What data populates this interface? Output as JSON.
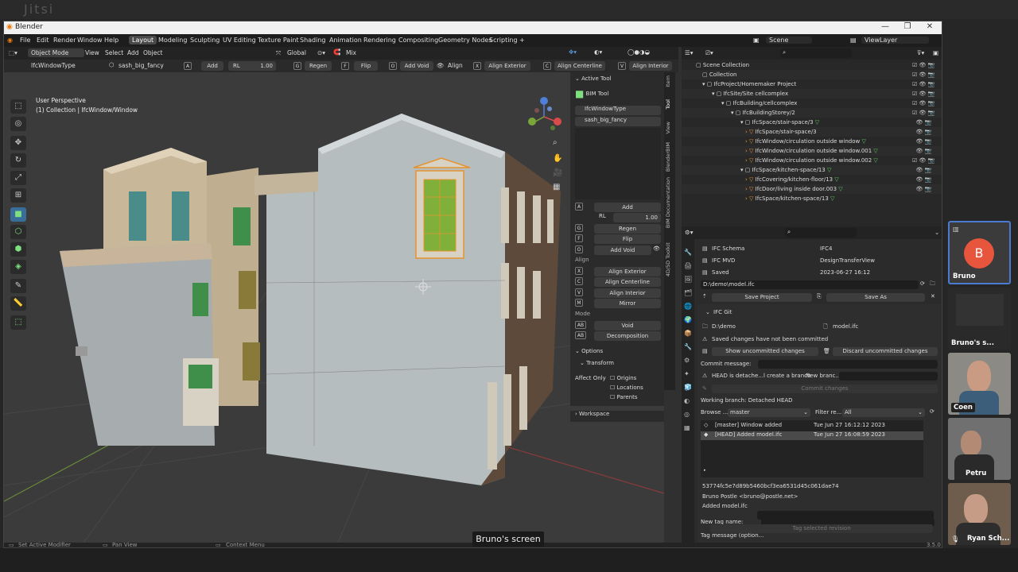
{
  "meeting": {
    "watermark": "Jitsi",
    "caption": "Bruno's screen",
    "participants": [
      {
        "name": "Bruno",
        "initial": "B",
        "accent": "#e8553d"
      },
      {
        "name": "Bruno's s..."
      },
      {
        "name": "Coen"
      },
      {
        "name": "Petru"
      },
      {
        "name": "Ryan Sch..."
      }
    ]
  },
  "window": {
    "title": "Blender"
  },
  "menu": {
    "items": [
      "File",
      "Edit",
      "Render",
      "Window",
      "Help"
    ],
    "workspaces": [
      "Layout",
      "Modeling",
      "Sculpting",
      "UV Editing",
      "Texture Paint",
      "Shading",
      "Animation",
      "Rendering",
      "Compositing",
      "Geometry Nodes",
      "Scripting",
      "+"
    ],
    "scene": "Scene",
    "view_layer": "ViewLayer"
  },
  "viewport": {
    "header": {
      "mode": "Object Mode",
      "view": "View",
      "select": "Select",
      "add": "Add",
      "object": "Object",
      "orientation": "Global",
      "shading": "Mix"
    },
    "toolheader": {
      "type": "IfcWindowType",
      "element": "sash_big_fancy",
      "a": "A",
      "add": "Add",
      "rl": "RL",
      "rl_value": "1.00",
      "g": "G",
      "regen": "Regen",
      "f": "F",
      "flip": "Flip",
      "o": "O",
      "add_void": "Add Void",
      "align": "Align",
      "x": "X",
      "align_exterior": "Align Exterior",
      "c": "C",
      "align_centerline": "Align Centerline",
      "v": "V",
      "align_interior": "Align Interior"
    },
    "perspective": "User Perspective",
    "collection": "(1) Collection | IfcWindow/Window"
  },
  "toolpanel": {
    "active_tool": "Active Tool",
    "bim_tool": "BIM Tool",
    "type": "IfcWindowType",
    "element": "sash_big_fancy",
    "add": "Add",
    "rl": "RL",
    "rl_value": "1.00",
    "regen": "Regen",
    "flip": "Flip",
    "add_void": "Add Void",
    "align": "Align",
    "align_exterior": "Align Exterior",
    "align_centerline": "Align Centerline",
    "align_interior": "Align Interior",
    "mirror": "Mirror",
    "mode": "Mode",
    "void": "Void",
    "decomposition": "Decomposition",
    "options": "Options",
    "transform": "Transform",
    "affect_only": "Affect Only",
    "origins": "Origins",
    "locations": "Locations",
    "parents": "Parents",
    "workspace": "Workspace",
    "keys": {
      "a": "A",
      "g": "G",
      "f": "F",
      "o": "O",
      "x": "X",
      "c": "C",
      "v": "V",
      "m": "M",
      "ab": "AB",
      "d": "D"
    }
  },
  "vtabs": [
    "Item",
    "Tool",
    "View",
    "BlenderBIM",
    "BIM Documentation",
    "4D/5D Toolkit"
  ],
  "outliner": {
    "rows": [
      "Scene Collection",
      "Collection",
      "IfcProject/Homemaker Project",
      "IfcSite/Site cellcomplex",
      "IfcBuilding/cellcomplex",
      "IfcBuildingStorey/2",
      "IfcSpace/stair-space/3",
      "IfcSpace/stair-space/3",
      "IfcWindow/circulation outside window",
      "IfcWindow/circulation outside window.001",
      "IfcWindow/circulation outside window.002",
      "IfcSpace/kitchen-space/13",
      "IfcCovering/kitchen-floor/13",
      "IfcDoor/living inside door.003",
      "IfcSpace/kitchen-space/13"
    ]
  },
  "props": {
    "ifc_schema_label": "IFC Schema",
    "ifc_schema": "IFC4",
    "ifc_mvd_label": "IFC MVD",
    "ifc_mvd": "DesignTransferView",
    "saved_label": "Saved",
    "saved": "2023-06-27 16:12",
    "path": "D:\\demo\\model.ifc",
    "save_project": "Save Project",
    "save_as": "Save As",
    "ifc_git": "IFC Git",
    "repo_dir": "D:\\demo",
    "repo_file": "model.ifc",
    "warn_uncommitted": "Saved changes have not been committed",
    "show_uncommitted": "Show uncommitted changes",
    "discard_uncommitted": "Discard uncommitted changes",
    "commit_message_label": "Commit message:",
    "head_detached": "HEAD is detache...l create a branch",
    "new_branch": "New branc...",
    "commit_changes": "Commit changes",
    "working_branch": "Working branch: Detached HEAD",
    "browse_label": "Browse ...",
    "browse_value": "master",
    "filter_label": "Filter re...",
    "filter_value": "All",
    "commits": [
      {
        "msg": "[master] Window added",
        "date": "Tue Jun 27 16:12:12 2023"
      },
      {
        "msg": "[HEAD] Added model.ifc",
        "date": "Tue Jun 27 16:08:59 2023"
      }
    ],
    "hash": "53774fc5e7d89b5460bcf3ea6531d45c061dae74",
    "author": "Bruno Postle <bruno@postle.net>",
    "commit_msg": "Added model.ifc",
    "new_tag_label": "New tag name:",
    "tag_message_label": "Tag message (option...",
    "tag_selected": "Tag selected revision"
  },
  "status": {
    "left": "Set Active Modifier",
    "mid": "Pan View",
    "right": "Context Menu",
    "version": "3.5.0"
  }
}
